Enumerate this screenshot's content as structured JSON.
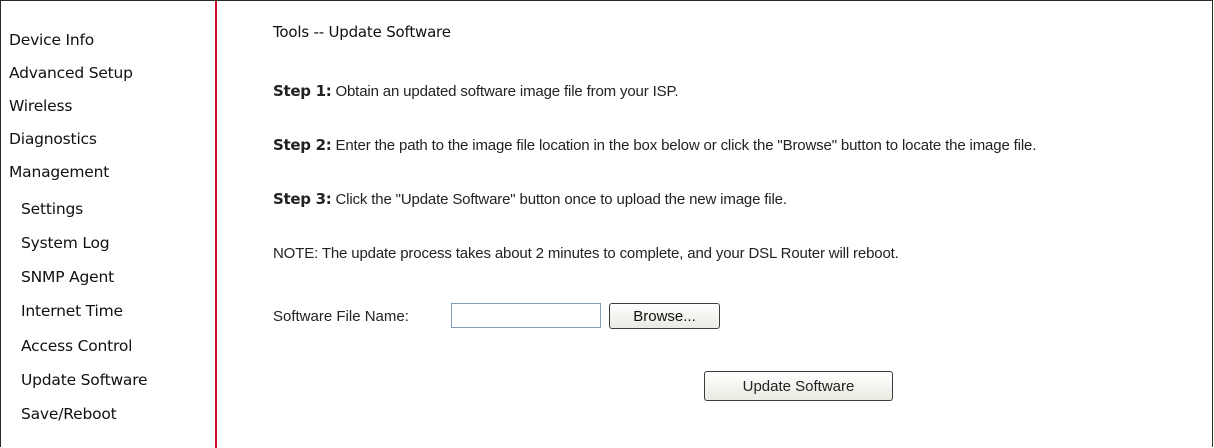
{
  "sidebar": {
    "items": [
      {
        "label": "Device Info"
      },
      {
        "label": "Advanced Setup"
      },
      {
        "label": "Wireless"
      },
      {
        "label": "Diagnostics"
      },
      {
        "label": "Management"
      },
      {
        "label": "Settings"
      },
      {
        "label": "System Log"
      },
      {
        "label": "SNMP Agent"
      },
      {
        "label": "Internet Time"
      },
      {
        "label": "Access Control"
      },
      {
        "label": "Update Software"
      },
      {
        "label": "Save/Reboot"
      }
    ]
  },
  "main": {
    "title": "Tools -- Update Software",
    "step1_label": "Step 1:",
    "step1_text": " Obtain an updated software image file from your ISP.",
    "step2_label": "Step 2:",
    "step2_text": " Enter the path to the image file location in the box below or click the \"Browse\" button to locate the image file.",
    "step3_label": "Step 3:",
    "step3_text": " Click the \"Update Software\" button once to upload the new image file.",
    "note": "NOTE: The update process takes about 2 minutes to complete, and your DSL Router will reboot.",
    "file_label": "Software File Name:",
    "file_value": "",
    "browse_label": "Browse...",
    "update_label": "Update Software"
  },
  "colors": {
    "sidebar_divider": "#c8102e",
    "text": "#222222"
  }
}
